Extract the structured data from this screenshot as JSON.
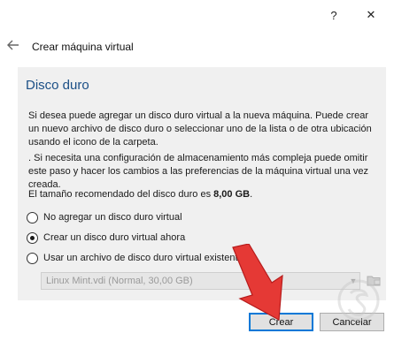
{
  "titlebar": {
    "help_label": "?",
    "close_label": "✕"
  },
  "header": {
    "title": "Crear máquina virtual"
  },
  "section": {
    "title": "Disco duro"
  },
  "paragraphs": {
    "p1": "Si desea puede agregar un disco duro virtual a la nueva máquina. Puede crear un nuevo archivo de disco duro o seleccionar uno de la lista o de otra ubicación usando el icono de la carpeta.",
    "p2": ". Si necesita una configuración de almacenamiento más compleja puede omitir este paso y hacer los cambios a las preferencias de la máquina virtual una vez creada.",
    "p3_prefix": "El tamaño recomendado del disco duro es ",
    "p3_value": "8,00 GB",
    "p3_suffix": "."
  },
  "options": [
    {
      "label": "No agregar un disco duro virtual",
      "checked": false
    },
    {
      "label": "Crear un disco duro virtual ahora",
      "checked": true
    },
    {
      "label": "Usar un archivo de disco duro virtual existente",
      "checked": false
    }
  ],
  "disk_combo": {
    "value": "Linux Mint.vdi (Normal, 30,00 GB)"
  },
  "buttons": {
    "create": "Crear",
    "cancel": "Cancelar"
  },
  "colors": {
    "section_title": "#1b4f86",
    "arrow_red": "#e53935",
    "focus_blue": "#0078d7"
  },
  "icons": [
    "help-icon",
    "close-icon",
    "back-arrow-icon",
    "chevron-down-icon",
    "folder-icon"
  ]
}
